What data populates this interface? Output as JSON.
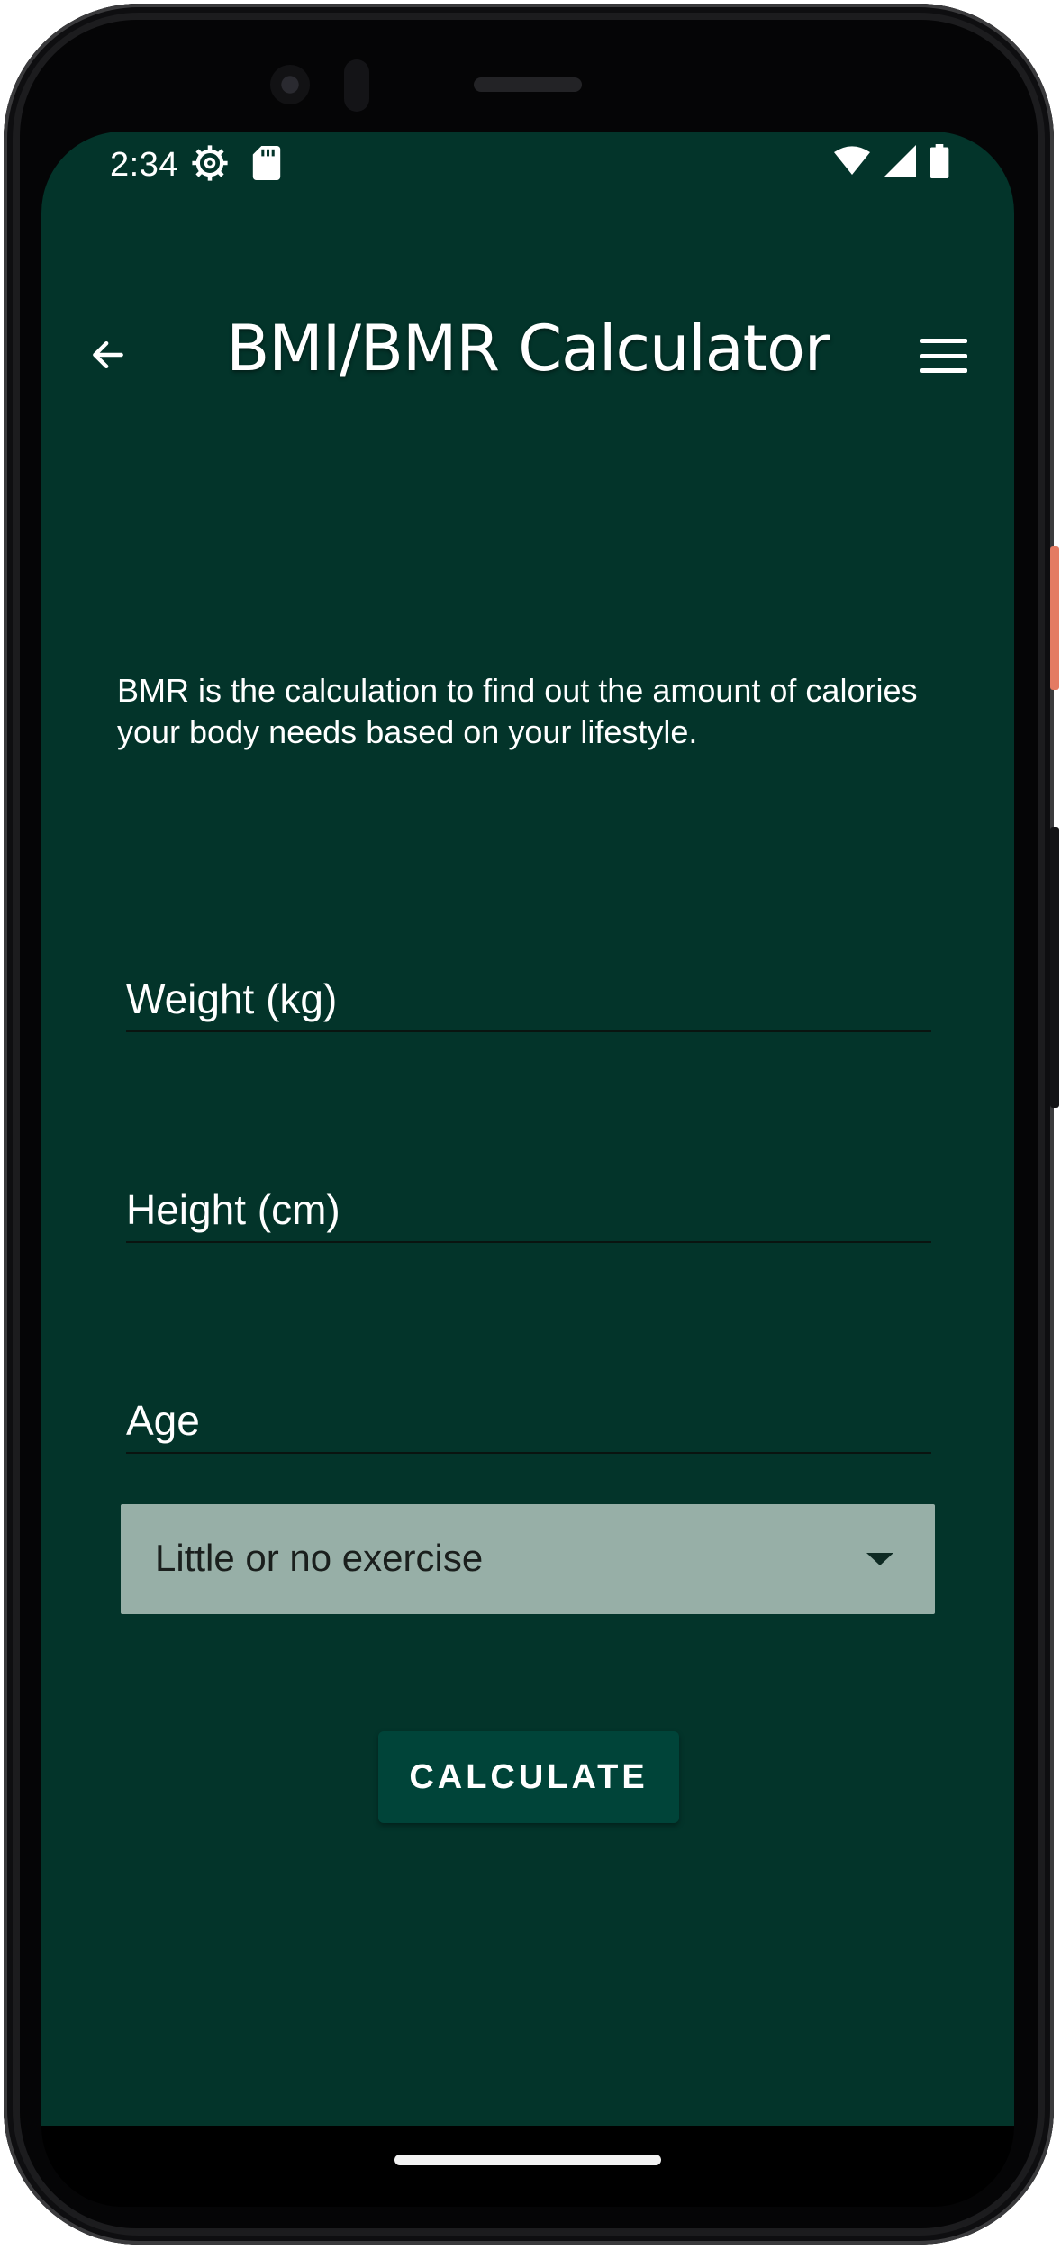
{
  "status_bar": {
    "time": "2:34",
    "icons": [
      "settings-icon",
      "sd-card-icon",
      "wifi-icon",
      "signal-icon",
      "battery-icon"
    ]
  },
  "app_bar": {
    "title": "BMI/BMR Calculator",
    "back_icon": "arrow-left-icon",
    "menu_icon": "hamburger-menu-icon"
  },
  "main": {
    "description": "BMR is the calculation to find out the amount of calories your body needs based on your lifestyle.",
    "fields": {
      "weight_placeholder": "Weight (kg)",
      "height_placeholder": "Height (cm)",
      "age_placeholder": "Age"
    },
    "activity_select": {
      "selected": "Little or no exercise"
    },
    "calculate_label": "CALCULATE"
  },
  "colors": {
    "screen_background": "#03342a",
    "dropdown_background": "#97afa7",
    "button_background": "#004439",
    "text": "#ffffff"
  }
}
